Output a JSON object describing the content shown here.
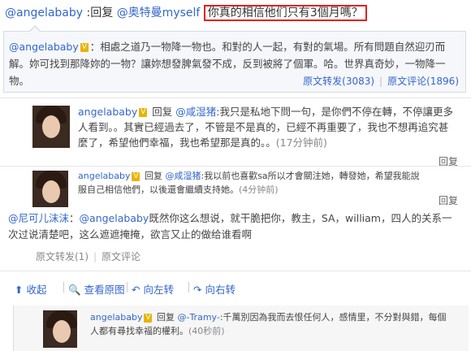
{
  "top": {
    "user": "@angelababy",
    "reply": ":回复",
    "mention": "@奥特曼myself",
    "highlight": "你真的相信他们只有3個月嗎？"
  },
  "quote": {
    "user": "@angelababy",
    "badge": "V",
    "text": "：相處之道乃一物降一物也。和對的人一起，有對的氣場。所有問題自然迎刃而解。妳可找到那降妳的一物？讓妳想發脾氣發不成，反到被將了個軍。哈。世界真奇妙，一物降一物。",
    "repost": "原文转发(3083)",
    "comment": "原文评论(1896)"
  },
  "comments": [
    {
      "user": "angelababy",
      "badge": "V",
      "verb": "回复",
      "target": "@咸湿猪",
      "text": ":我只是私地下問一句，是你們不停在轉，不停讓更多人看到。。其實已經過去了，不管是不是真的，已經不再重要了，我也不想再追究甚麼了，希望他們幸福，我也希望那是真的。。",
      "time": "(17分钟前)",
      "reply": "回复"
    },
    {
      "user": "angelababy",
      "badge": "V",
      "verb": "回复",
      "target": "@咸湿猪",
      "text": ":我以前也喜歡sa所以才會關注她，轉發她，希望我能說服自己相信他們，以後還會繼續支持她。",
      "time": "(4分钟前)",
      "reply": "回复"
    }
  ],
  "repost": {
    "user": "@尼可儿沫沫",
    "mention": "@angelababy",
    "text": "既然你这么想说，就干脆把你，教主，SA，william，四人的关系一次过说清楚吧，这么遮遮掩掩，欲言又止的做给谁看啊",
    "repost": "原文转发(1)",
    "comment": "原文评论"
  },
  "toolbar": {
    "collapse": "收起",
    "view_original": "查看原图",
    "rotate_left": "向左转",
    "rotate_right": "向右转"
  },
  "bottom": {
    "user": "angelababy",
    "badge": "V",
    "verb": "回复",
    "target": "@-Tramy-",
    "text": ":千萬別因為我而去恨任何人，感情里，不分對與錯，每個人都有尋找幸福的權利。",
    "time": "(40秒前)"
  }
}
